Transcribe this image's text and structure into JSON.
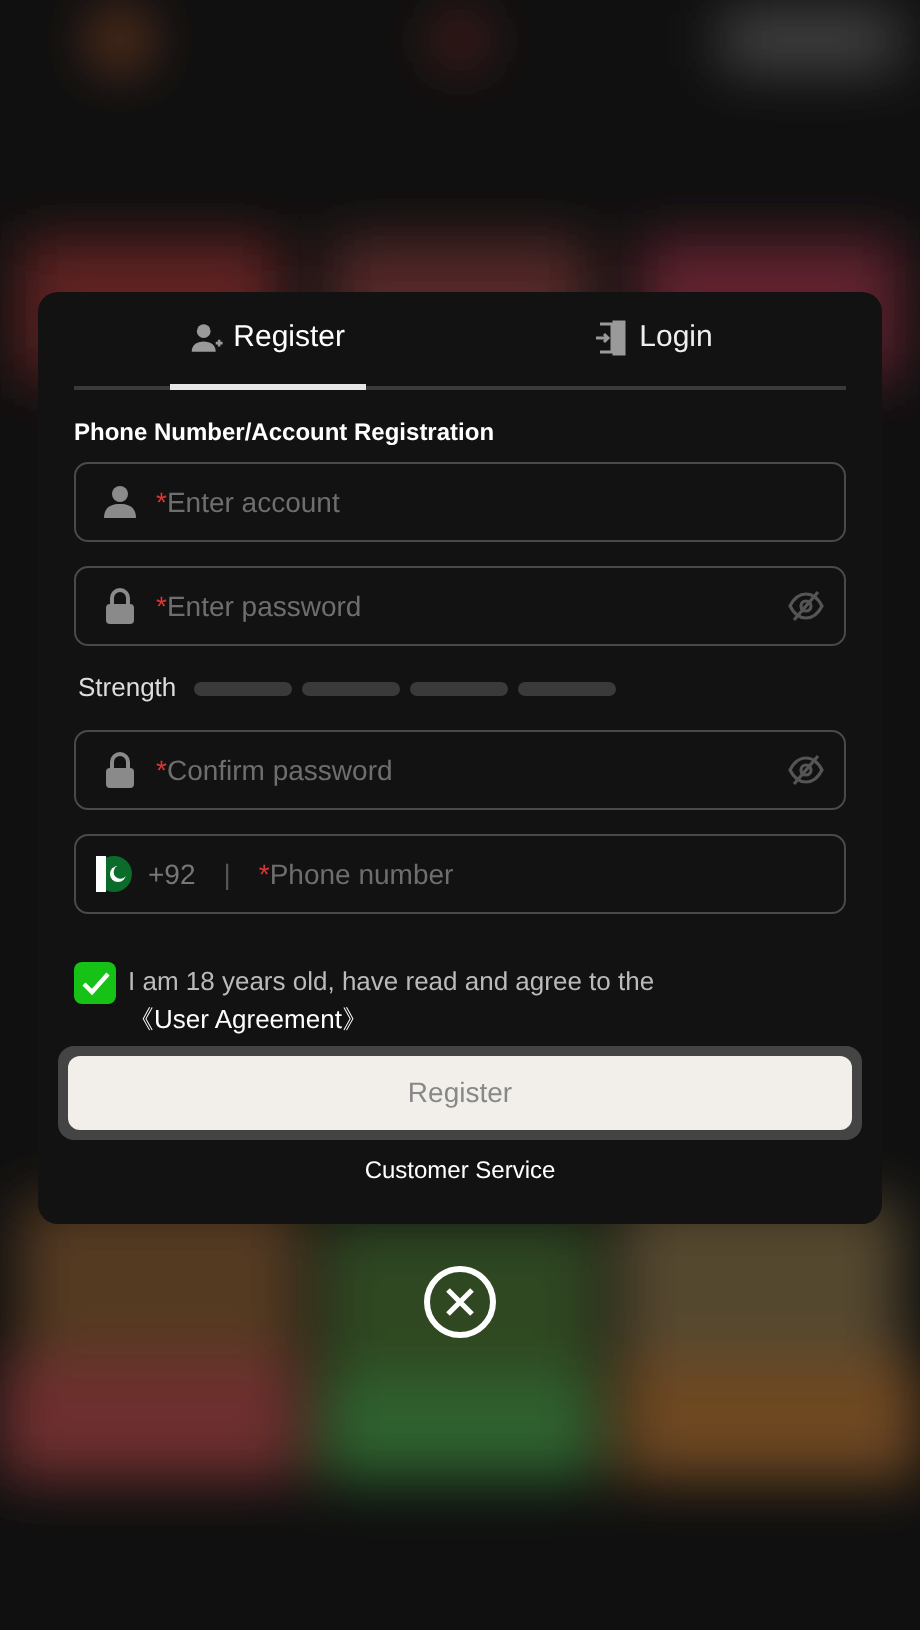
{
  "tabs": [
    {
      "label": "Register",
      "selected": true
    },
    {
      "label": "Login",
      "selected": false
    }
  ],
  "section_title": "Phone Number/Account Registration",
  "fields": [
    {
      "kind": "account",
      "mark": "*",
      "placeholder": "Enter account"
    },
    {
      "kind": "password",
      "mark": "*",
      "placeholder": "Enter password",
      "visible": false
    },
    {
      "kind": "strength",
      "label": "Strength"
    },
    {
      "kind": "password",
      "mark": "*",
      "placeholder": "Confirm password",
      "visible": false
    },
    {
      "kind": "phone",
      "code": "+92",
      "divider": "|",
      "mark": "*",
      "placeholder": "Phone number"
    }
  ],
  "agreement": {
    "checked": true,
    "text": "I am 18 years old, have read and agree to the ",
    "link": "《User Agreement》"
  },
  "submit": {
    "label": "Register",
    "disabled": true
  },
  "service_link": "Customer Service",
  "close": {
    "visible": true
  }
}
